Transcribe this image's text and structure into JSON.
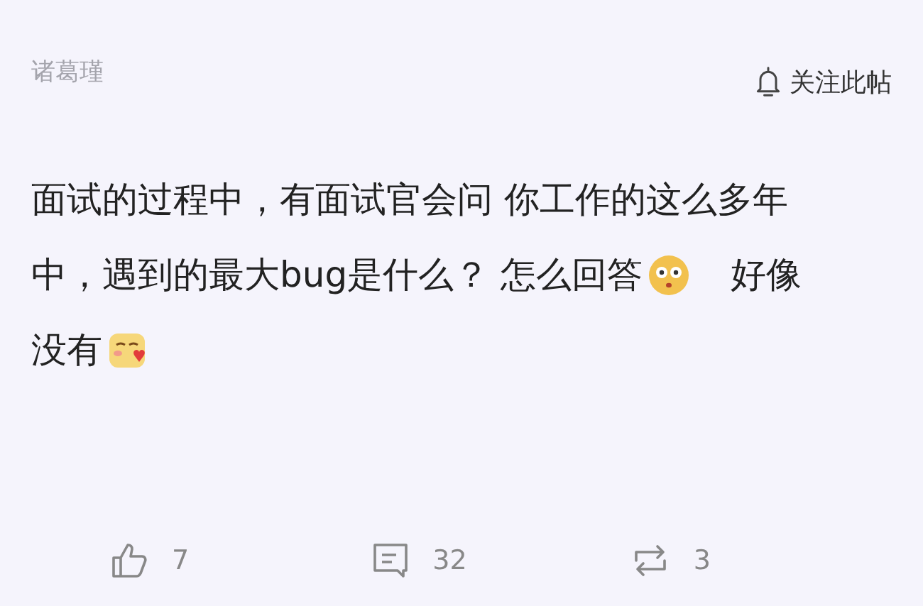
{
  "author": {
    "name": "诸葛瑾"
  },
  "follow": {
    "label": "关注此帖"
  },
  "post": {
    "lines": [
      [
        {
          "kind": "text",
          "text": "面试的过程中，有面试官会问 你工作的这么多年"
        }
      ],
      [
        {
          "kind": "text",
          "text": "中，遇到的最大bug是什么？ 怎么回答"
        },
        {
          "kind": "flushed"
        },
        {
          "kind": "text",
          "text": "好像"
        }
      ],
      [
        {
          "kind": "text",
          "text": "没有"
        },
        {
          "kind": "shy"
        }
      ]
    ]
  },
  "actions": [
    {
      "kind": "like",
      "count": "7"
    },
    {
      "kind": "comment",
      "count": "32"
    },
    {
      "kind": "repost",
      "count": "3"
    }
  ]
}
